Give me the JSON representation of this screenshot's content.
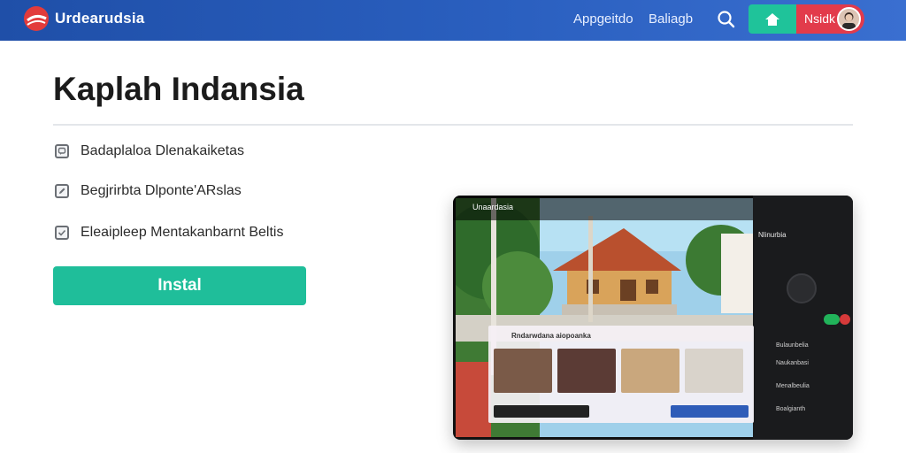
{
  "header": {
    "brand": "Urdearudsia",
    "nav": [
      "Appgeitdo",
      "Baliagb"
    ],
    "user_label": "Nsidk"
  },
  "main": {
    "title": "Kaplah Indansia",
    "features": [
      {
        "label": "Badaplaloa Dlenakaiketas",
        "icon": "chat-icon"
      },
      {
        "label": "Begjrirbta Dlponte'ARslas",
        "icon": "edit-icon"
      },
      {
        "label": "Eleaipleep Mentakanbarnt Beltis",
        "icon": "check-icon"
      }
    ],
    "install_label": "Instal"
  },
  "preview": {
    "status_title": "Unaardasia",
    "side_heading": "Nlinurbia",
    "side_items": [
      "Bulaunbelia",
      "Naukanbasi",
      "Menalbeulia",
      "Boalgianth"
    ],
    "panel_title": "Rndarwdana aiopoanka"
  },
  "colors": {
    "header": "#2a5fbf",
    "accent_green": "#1fbe9a",
    "accent_red": "#e23b4b"
  }
}
